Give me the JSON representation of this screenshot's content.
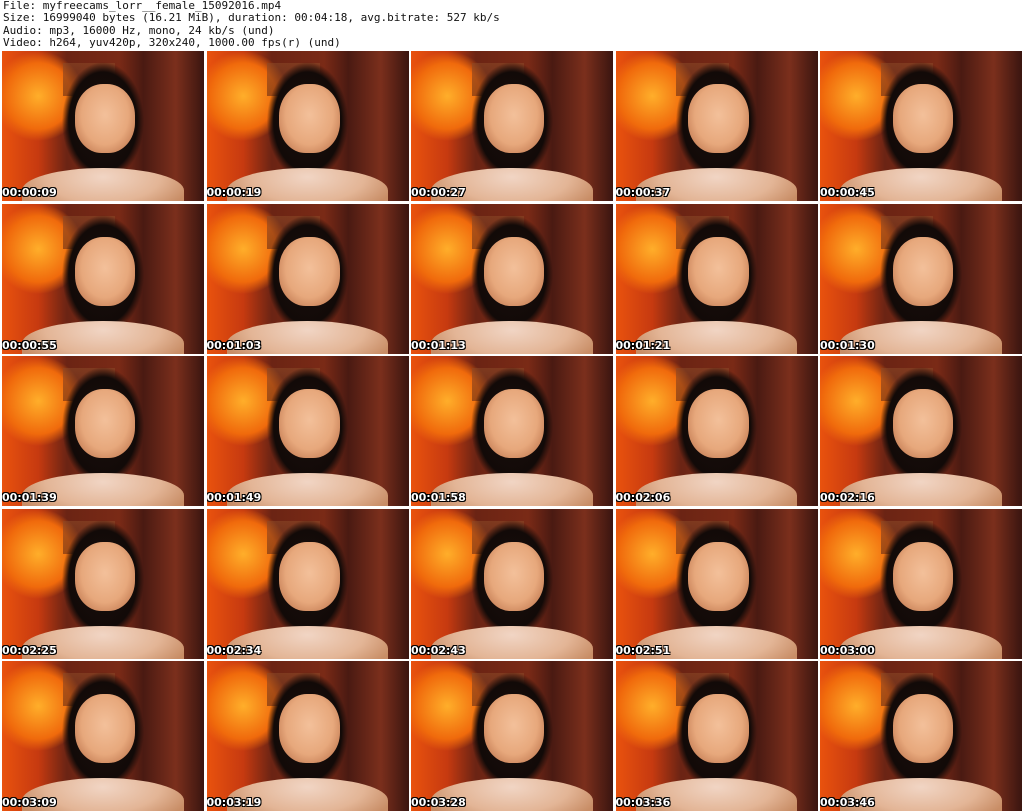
{
  "header": {
    "file_line": "File: myfreecams_lorr__female_15092016.mp4",
    "size_line": "Size: 16999040 bytes (16.21 MiB), duration: 00:04:18, avg.bitrate: 527 kb/s",
    "audio_line": "Audio: mp3, 16000 Hz, mono, 24 kb/s (und)",
    "video_line": "Video: h264, yuv420p, 320x240, 1000.00 fps(r) (und)"
  },
  "thumbnails": [
    {
      "time": "00:00:09"
    },
    {
      "time": "00:00:19"
    },
    {
      "time": "00:00:27"
    },
    {
      "time": "00:00:37"
    },
    {
      "time": "00:00:45"
    },
    {
      "time": "00:00:55"
    },
    {
      "time": "00:01:03"
    },
    {
      "time": "00:01:13"
    },
    {
      "time": "00:01:21"
    },
    {
      "time": "00:01:30"
    },
    {
      "time": "00:01:39"
    },
    {
      "time": "00:01:49"
    },
    {
      "time": "00:01:58"
    },
    {
      "time": "00:02:06"
    },
    {
      "time": "00:02:16"
    },
    {
      "time": "00:02:25"
    },
    {
      "time": "00:02:34"
    },
    {
      "time": "00:02:43"
    },
    {
      "time": "00:02:51"
    },
    {
      "time": "00:03:00"
    },
    {
      "time": "00:03:09"
    },
    {
      "time": "00:03:19"
    },
    {
      "time": "00:03:28"
    },
    {
      "time": "00:03:36"
    },
    {
      "time": "00:03:46"
    }
  ]
}
